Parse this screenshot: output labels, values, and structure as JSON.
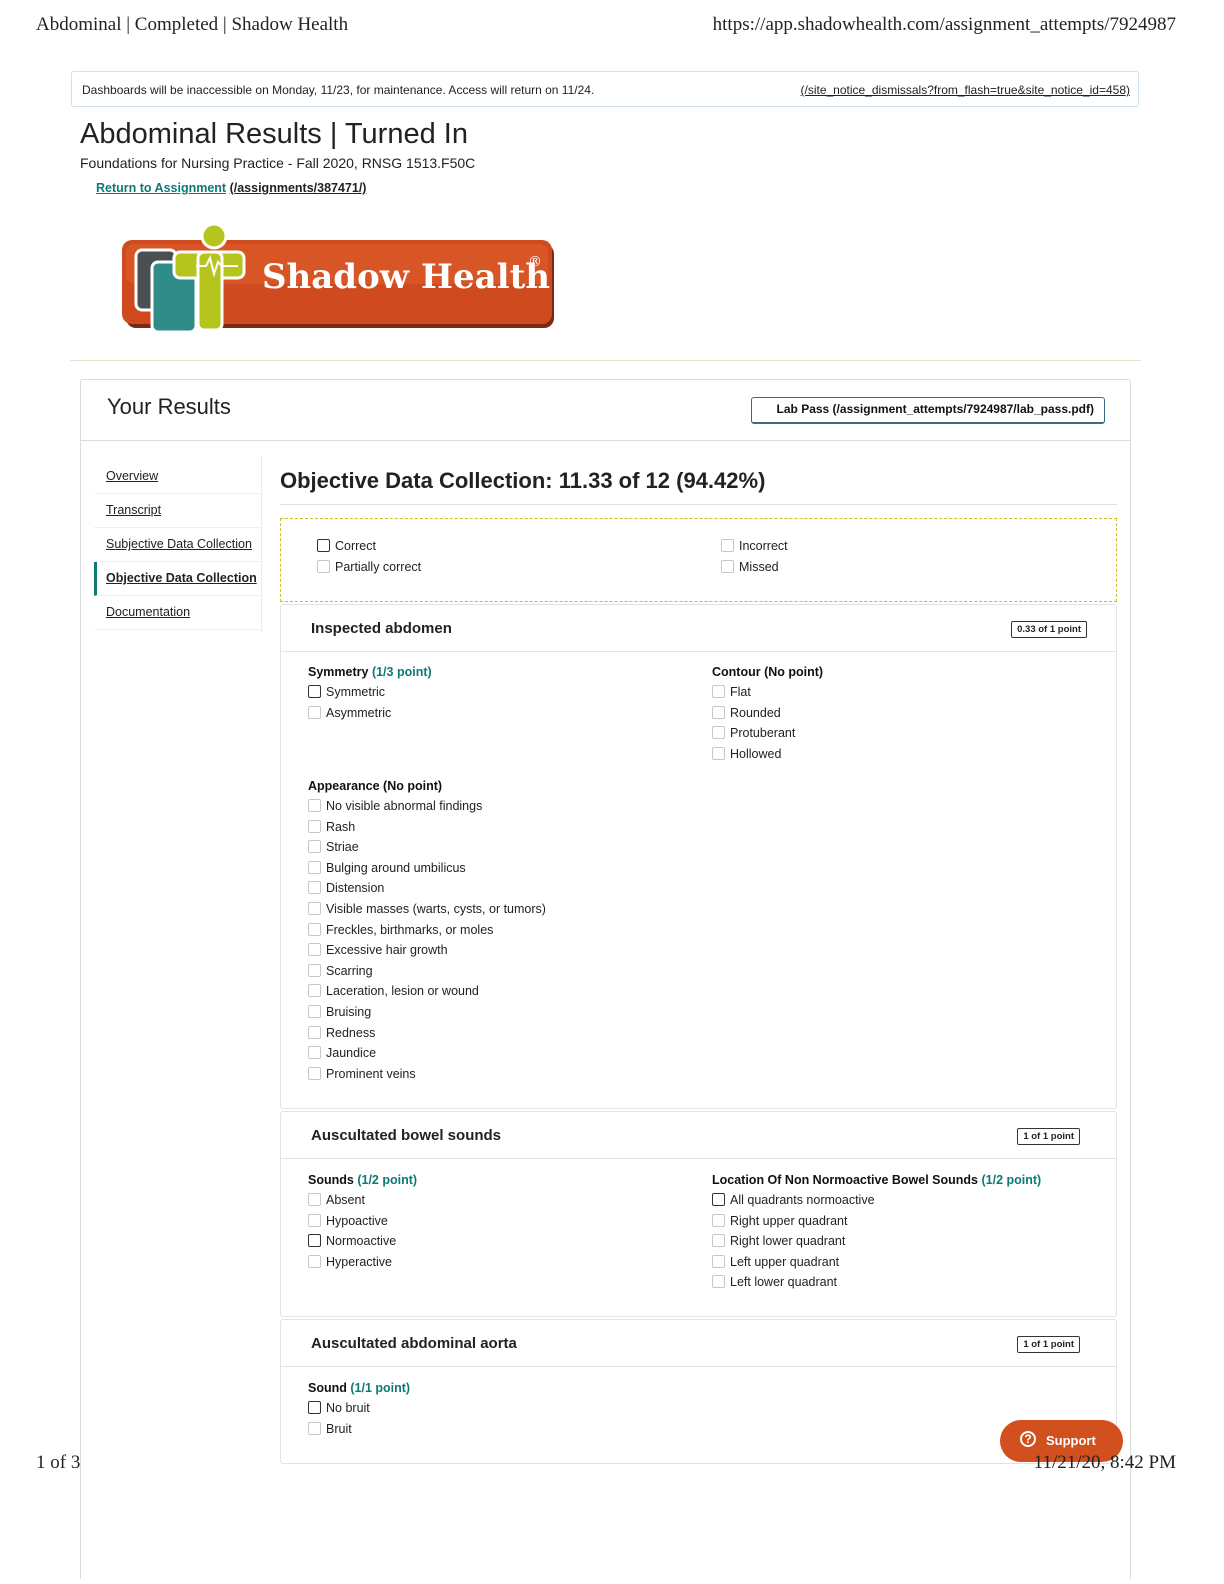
{
  "print_header": {
    "title": "Abdominal | Completed | Shadow Health",
    "url": "https://app.shadowhealth.com/assignment_attempts/7924987"
  },
  "notice": {
    "message": "Dashboards will be inaccessible on Monday, 11/23, for maintenance. Access will return on 11/24.",
    "dismiss_link": "(/site_notice_dismissals?from_flash=true&site_notice_id=458)"
  },
  "page": {
    "title": "Abdominal Results | Turned In",
    "subtitle": "Foundations for Nursing Practice - Fall 2020, RNSG 1513.F50C",
    "return_label": "Return to Assignment",
    "return_path": "(/assignments/387471/)"
  },
  "logo": {
    "text": "Shadow Health",
    "mark": "®"
  },
  "results": {
    "heading": "Your Results",
    "lab_pass": "Lab Pass (/assignment_attempts/7924987/lab_pass.pdf)"
  },
  "nav": {
    "items": [
      {
        "label": "Overview",
        "active": false
      },
      {
        "label": "Transcript",
        "active": false
      },
      {
        "label": "Subjective Data Collection",
        "active": false
      },
      {
        "label": "Objective Data Collection",
        "active": true
      },
      {
        "label": "Documentation",
        "active": false
      }
    ]
  },
  "section": {
    "title": "Objective Data Collection: 11.33 of 12 (94.42%)"
  },
  "legend": {
    "left": [
      "Correct",
      "Partially correct"
    ],
    "right": [
      "Incorrect",
      "Missed"
    ]
  },
  "cards": {
    "inspected": {
      "title": "Inspected abdomen",
      "badge": "0.33 of 1 point",
      "symmetry": {
        "label": "Symmetry",
        "points": "(1/3 point)",
        "options": [
          "Symmetric",
          "Asymmetric"
        ]
      },
      "contour": {
        "label": "Contour",
        "points": "(No point)",
        "options": [
          "Flat",
          "Rounded",
          "Protuberant",
          "Hollowed"
        ]
      },
      "appearance": {
        "label": "Appearance",
        "points": "(No point)",
        "options": [
          "No visible abnormal findings",
          "Rash",
          "Striae",
          "Bulging around umbilicus",
          "Distension",
          "Visible masses (warts, cysts, or tumors)",
          "Freckles, birthmarks, or moles",
          "Excessive hair growth",
          "Scarring",
          "Laceration, lesion or wound",
          "Bruising",
          "Redness",
          "Jaundice",
          "Prominent veins"
        ]
      }
    },
    "bowel": {
      "title": "Auscultated bowel sounds",
      "badge": "1 of 1 point",
      "sounds": {
        "label": "Sounds",
        "points": "(1/2 point)",
        "options": [
          "Absent",
          "Hypoactive",
          "Normoactive",
          "Hyperactive"
        ]
      },
      "location": {
        "label": "Location Of Non Normoactive Bowel Sounds",
        "points": "(1/2 point)",
        "options": [
          "All quadrants normoactive",
          "Right upper quadrant",
          "Right lower quadrant",
          "Left upper quadrant",
          "Left lower quadrant"
        ]
      }
    },
    "aorta": {
      "title": "Auscultated abdominal aorta",
      "badge": "1 of 1 point",
      "sound": {
        "label": "Sound",
        "points": "(1/1 point)",
        "options": [
          "No bruit",
          "Bruit"
        ]
      }
    }
  },
  "support": {
    "label": "Support"
  },
  "footer": {
    "page": "1 of 3",
    "datetime": "11/21/20, 8:42 PM"
  }
}
